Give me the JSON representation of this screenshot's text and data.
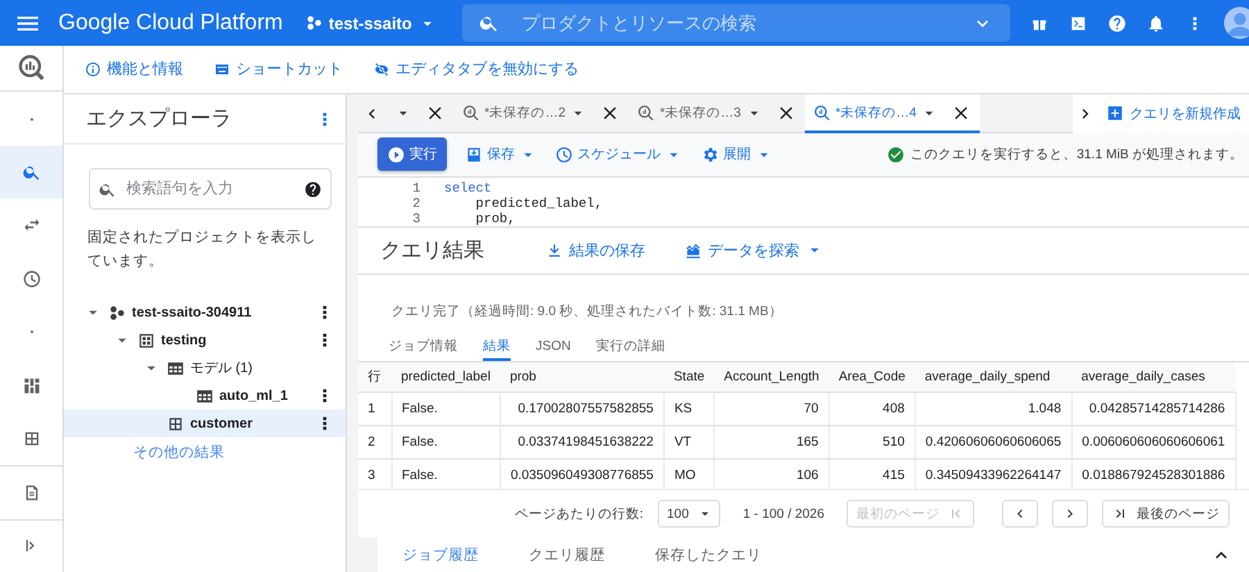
{
  "topbar": {
    "product": "Google Cloud Platform",
    "project": "test-ssaito",
    "search_placeholder": "プロダクトとリソースの検索"
  },
  "toolbar": [
    {
      "kind": "info",
      "label": "機能と情報"
    },
    {
      "kind": "keyboard",
      "label": "ショートカット"
    },
    {
      "kind": "hide",
      "label": "エディタタブを無効にする"
    }
  ],
  "rail": {
    "items": [
      {
        "kind": "dot",
        "selected": false
      },
      {
        "kind": "search",
        "selected": true
      },
      {
        "kind": "transfer",
        "selected": false
      },
      {
        "kind": "history",
        "selected": false
      },
      {
        "kind": "dot",
        "selected": false
      },
      {
        "kind": "dashboard",
        "selected": false
      },
      {
        "kind": "table",
        "selected": false
      }
    ],
    "bottom": [
      {
        "kind": "notes"
      },
      {
        "kind": "expand"
      }
    ]
  },
  "explorer": {
    "title": "エクスプローラ",
    "search_placeholder": "検索語句を入力",
    "pinned_note": "固定されたプロジェクトを表示しています。",
    "tree": [
      {
        "label": "test-ssaito-304911",
        "kind": "project",
        "expanded": true,
        "selected": false,
        "children": [
          {
            "label": "testing",
            "kind": "dataset",
            "expanded": true,
            "selected": false,
            "children": [
              {
                "label": "モデル (1)",
                "kind": "models",
                "expanded": true,
                "selected": false,
                "children": [
                  {
                    "label": "auto_ml_1",
                    "kind": "model",
                    "selected": false
                  }
                ]
              },
              {
                "label": "customer",
                "kind": "table",
                "selected": true
              }
            ]
          }
        ]
      }
    ],
    "more_link": "その他の結果"
  },
  "editor_tabs": [
    {
      "kind": "clipped",
      "selected": false
    },
    {
      "kind": "query",
      "label": "*未保存の…2",
      "selected": false
    },
    {
      "kind": "query",
      "label": "*未保存の…3",
      "selected": false
    },
    {
      "kind": "query",
      "label": "*未保存の…4",
      "selected": true
    }
  ],
  "new_query": "クエリを新規作成",
  "actions": [
    {
      "kind": "run",
      "label": "実行"
    },
    {
      "kind": "save",
      "label": "保存"
    },
    {
      "kind": "schedule",
      "label": "スケジュール"
    },
    {
      "kind": "deploy",
      "label": "展開"
    }
  ],
  "validation": "このクエリを実行すると、31.1 MiB が処理されます。",
  "editor": [
    {
      "number": "1",
      "code": "select",
      "kind": "keyword"
    },
    {
      "number": "2",
      "code": "    predicted_label,",
      "kind": "plain"
    },
    {
      "number": "3",
      "code": "    prob,",
      "kind": "plain"
    }
  ],
  "results": {
    "title": "クエリ結果",
    "actions": [
      {
        "kind": "download",
        "label": "結果の保存"
      },
      {
        "kind": "chart",
        "label": "データを探索"
      }
    ],
    "summary": "クエリ完了（経過時間: 9.0 秒、処理されたバイト数: 31.1 MB）",
    "tabs": [
      {
        "label": "ジョブ情報",
        "selected": false
      },
      {
        "label": "結果",
        "selected": true
      },
      {
        "label": "JSON",
        "selected": false
      },
      {
        "label": "実行の詳細",
        "selected": false
      }
    ],
    "table": {
      "columns": [
        "行",
        "predicted_label",
        "prob",
        "State",
        "Account_Length",
        "Area_Code",
        "average_daily_spend",
        "average_daily_cases"
      ],
      "rows": [
        [
          "1",
          "False.",
          "0.17002807557582855",
          "KS",
          "70",
          "408",
          "1.048",
          "0.04285714285714286"
        ],
        [
          "2",
          "False.",
          "0.03374198451638222",
          "VT",
          "165",
          "510",
          "0.42060606060606065",
          "0.006060606060606061"
        ],
        [
          "3",
          "False.",
          "0.035096049308776855",
          "MO",
          "106",
          "415",
          "0.34509433962264147",
          "0.018867924528301886"
        ]
      ]
    },
    "pagination": {
      "rows_label": "ページあたりの行数:",
      "page_size": "100",
      "range": "1 - 100 / 2026",
      "first": {
        "label": "最初のページ",
        "disabled": true
      },
      "prev": {
        "disabled": false
      },
      "next": {
        "disabled": false
      },
      "last": {
        "label": "最後のページ",
        "disabled": false
      }
    }
  },
  "bottom_tabs": [
    {
      "label": "ジョブ履歴",
      "selected": true
    },
    {
      "label": "クエリ履歴",
      "selected": false
    },
    {
      "label": "保存したクエリ",
      "selected": false
    }
  ]
}
